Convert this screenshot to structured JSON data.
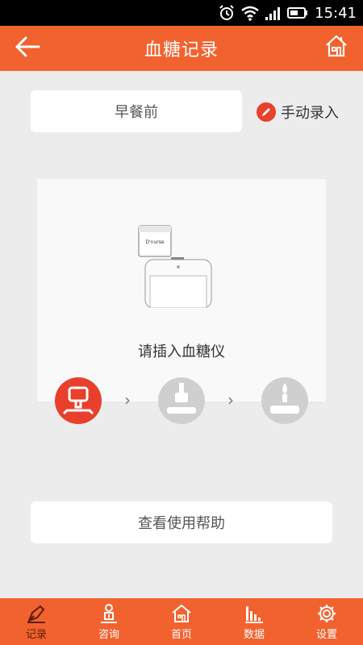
{
  "status_bar": {
    "time": "15:41"
  },
  "header": {
    "title": "血糖记录"
  },
  "meal_select": {
    "value": "早餐前"
  },
  "manual_entry": {
    "label": "手动录入"
  },
  "guide": {
    "instruction": "请插入血糖仪",
    "device_brand": "D'nurse"
  },
  "help_button": {
    "label": "查看使用帮助"
  },
  "tabs": [
    {
      "label": "记录",
      "icon": "pen-icon",
      "active": true
    },
    {
      "label": "咨询",
      "icon": "consult-icon",
      "active": false
    },
    {
      "label": "首页",
      "icon": "home-icon",
      "active": false
    },
    {
      "label": "数据",
      "icon": "chart-icon",
      "active": false
    },
    {
      "label": "设置",
      "icon": "gear-icon",
      "active": false
    }
  ],
  "colors": {
    "accent": "#f2622f",
    "active_step": "#e8402c",
    "inactive_step": "#cfcfcf"
  }
}
